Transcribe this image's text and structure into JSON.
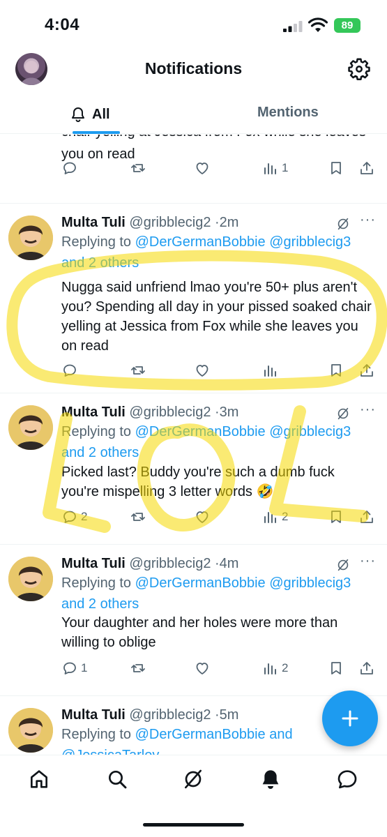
{
  "status": {
    "time": "4:04",
    "battery": "89"
  },
  "header": {
    "title": "Notifications",
    "tabs": {
      "all": "All",
      "mentions": "Mentions"
    }
  },
  "posts": [
    {
      "text": "chair yelling at Jessica from Fox while she leaves you on read",
      "views": "1"
    },
    {
      "name": "Multa Tuli",
      "handle": "@gribblecig2",
      "time": "2m",
      "replying_prefix": "Replying to",
      "mentions": "@DerGermanBobbie @gribblecig3 and 2 others",
      "text": "Nugga said unfriend lmao you're 50+ plus aren't you? Spending all day in your pissed soaked chair yelling at Jessica from Fox while she leaves you on read",
      "replies": "",
      "views": ""
    },
    {
      "name": "Multa Tuli",
      "handle": "@gribblecig2",
      "time": "3m",
      "replying_prefix": "Replying to",
      "mentions": "@DerGermanBobbie @gribblecig3 and 2 others",
      "text": "Picked last? Buddy you're such a dumb fuck you're mispelling 3 letter words 🤣",
      "replies": "2",
      "views": "2"
    },
    {
      "name": "Multa Tuli",
      "handle": "@gribblecig2",
      "time": "4m",
      "replying_prefix": "Replying to",
      "mentions": "@DerGermanBobbie @gribblecig3 and 2 others",
      "text": "Your daughter and her holes were more than willing to oblige",
      "replies": "1",
      "views": "2"
    },
    {
      "name": "Multa Tuli",
      "handle": "@gribblecig2",
      "time": "5m",
      "replying_prefix": "Replying to",
      "mentions": "@DerGermanBobbie and @JessicaTarlov"
    }
  ],
  "icons": {
    "tab_all": "bell-outline-icon",
    "settings": "gear-icon",
    "actions": [
      "reply-icon",
      "repost-icon",
      "like-icon",
      "views-icon",
      "bookmark-icon",
      "share-icon"
    ],
    "nav": [
      "home-icon",
      "search-icon",
      "grok-icon",
      "bell-filled-icon",
      "messages-icon"
    ],
    "fab": "compose-plus-icon"
  },
  "colors": {
    "accent": "#1d9bf0",
    "text": "#0f1419",
    "muted": "#536471",
    "highlighter": "#f5d800",
    "battery": "#34c759"
  }
}
